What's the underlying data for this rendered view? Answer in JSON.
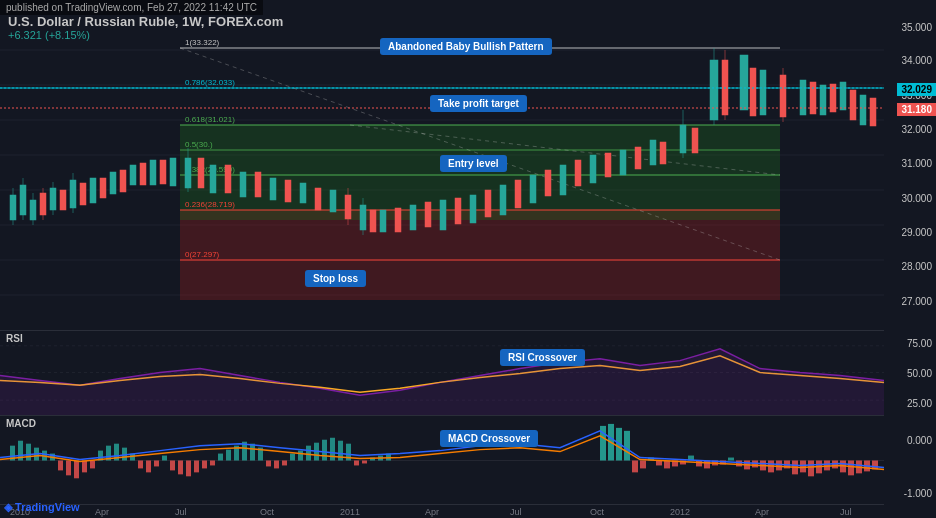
{
  "watermark": {
    "text": "published on TradingView.com, Feb 27, 2022 11:42 UTC"
  },
  "header": {
    "title": "U.S. Dollar / Russian Ruble, 1W, FOREX.com",
    "change": "+6.321 (+8.15%)"
  },
  "price_labels": {
    "right_axis": [
      "35.000",
      "34.000",
      "33.000",
      "32.000",
      "31.000",
      "30.000",
      "29.000",
      "28.000",
      "27.000"
    ],
    "current_price_1": "32.029",
    "current_price_2": "31.180"
  },
  "fib_levels": [
    {
      "label": "1(33.322)",
      "color": "#ffffff",
      "pct": 12
    },
    {
      "label": "0.786(32.033)",
      "color": "#00bcd4",
      "pct": 25
    },
    {
      "label": "0.618(31.021)",
      "color": "#4caf50",
      "pct": 35
    },
    {
      "label": "0.5(30.)",
      "color": "#4caf50",
      "pct": 42
    },
    {
      "label": "0.382(29.599)",
      "color": "#4caf50",
      "pct": 50
    },
    {
      "label": "0.236(28.719)",
      "color": "#f44336",
      "pct": 62
    },
    {
      "label": "0(27.297)",
      "color": "#f44336",
      "pct": 78
    }
  ],
  "annotations": [
    {
      "id": "abandoned_baby",
      "text": "Abandoned Baby Bullish Pattern",
      "color": "#1565c0"
    },
    {
      "id": "take_profit",
      "text": "Take profit target",
      "color": "#1976d2"
    },
    {
      "id": "entry_level",
      "text": "Entry level",
      "color": "#1976d2"
    },
    {
      "id": "stop_loss",
      "text": "Stop loss",
      "color": "#1565c0"
    },
    {
      "id": "rsi_crossover",
      "text": "RSI Crossover",
      "color": "#1976d2"
    },
    {
      "id": "macd_crossover",
      "text": "MACD Crossover",
      "color": "#1976d2"
    }
  ],
  "x_axis_labels": [
    "2010",
    "Apr",
    "Jul",
    "Oct",
    "2011",
    "Apr",
    "Jul",
    "Oct",
    "2012",
    "Apr",
    "Jul"
  ],
  "panels": {
    "rsi_label": "RSI",
    "macd_label": "MACD",
    "rsi_values": [
      "75.00",
      "50.00",
      "25.00"
    ],
    "macd_values": [
      "0.000",
      "-1.000"
    ]
  },
  "logo": {
    "text": "◈ TradingView"
  }
}
